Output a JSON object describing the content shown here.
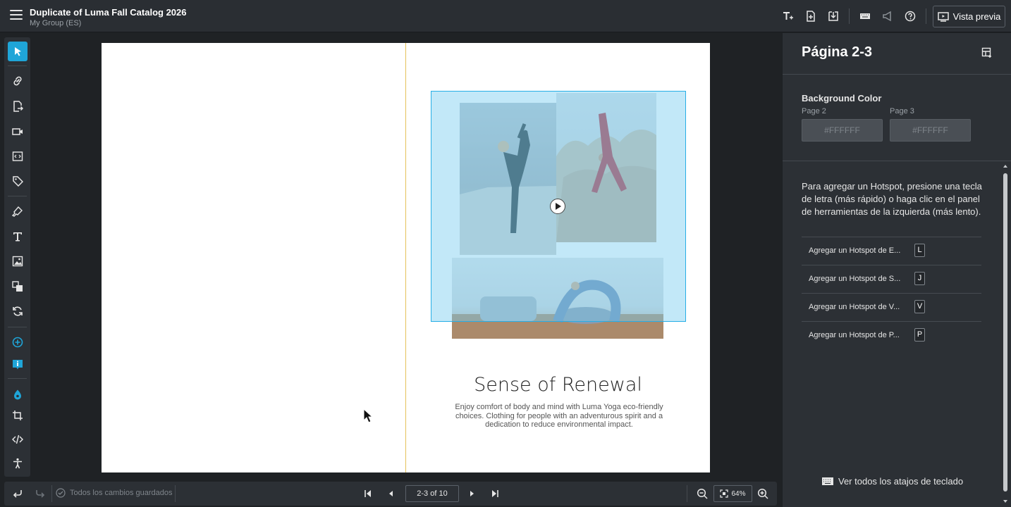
{
  "header": {
    "title": "Duplicate of Luma Fall Catalog 2026",
    "subtitle": "My Group (ES)",
    "preview_label": "Vista previa",
    "tool_icons": [
      "text-add-icon",
      "page-add-icon",
      "download-icon",
      "keyboard-icon",
      "megaphone-icon",
      "help-icon"
    ]
  },
  "left_toolbar": {
    "tools": [
      "cursor-icon",
      "link-icon",
      "page-link-icon",
      "video-icon",
      "embed-icon",
      "tag-icon",
      "marker-icon",
      "text-icon",
      "image-icon",
      "layers-icon",
      "refresh-icon",
      "add-circle-icon",
      "info-icon",
      "palette-icon",
      "crop-icon",
      "code-icon",
      "accessibility-icon"
    ]
  },
  "canvas": {
    "title": "Sense of Renewal",
    "body": "Enjoy comfort of body and mind with Luma Yoga eco-friendly choices. Clothing for people with an adventurous spirit and a dedication to reduce environmental impact."
  },
  "bottom_bar": {
    "saved_text": "Todos los cambios guardados",
    "page_indicator": "2-3 of 10",
    "zoom": "64%"
  },
  "panel": {
    "title": "Página 2-3",
    "bg_color_label": "Background Color",
    "page2_label": "Page 2",
    "page3_label": "Page 3",
    "page2_color": "#FFFFFF",
    "page3_color": "#FFFFFF",
    "help_text": "Para agregar un Hotspot, presione una tecla de letra (más rápido) o haga clic en el panel de herramientas de la izquierda (más lento).",
    "hotspots": [
      {
        "label": "Agregar un Hotspot de E...",
        "key": "L"
      },
      {
        "label": "Agregar un Hotspot de S...",
        "key": "J"
      },
      {
        "label": "Agregar un Hotspot de V...",
        "key": "V"
      },
      {
        "label": "Agregar un Hotspot de P...",
        "key": "P"
      }
    ],
    "shortcuts_label": "Ver todos los atajos de teclado"
  },
  "colors": {
    "accent": "#1fa5d8",
    "spine": "#e6c25a"
  }
}
